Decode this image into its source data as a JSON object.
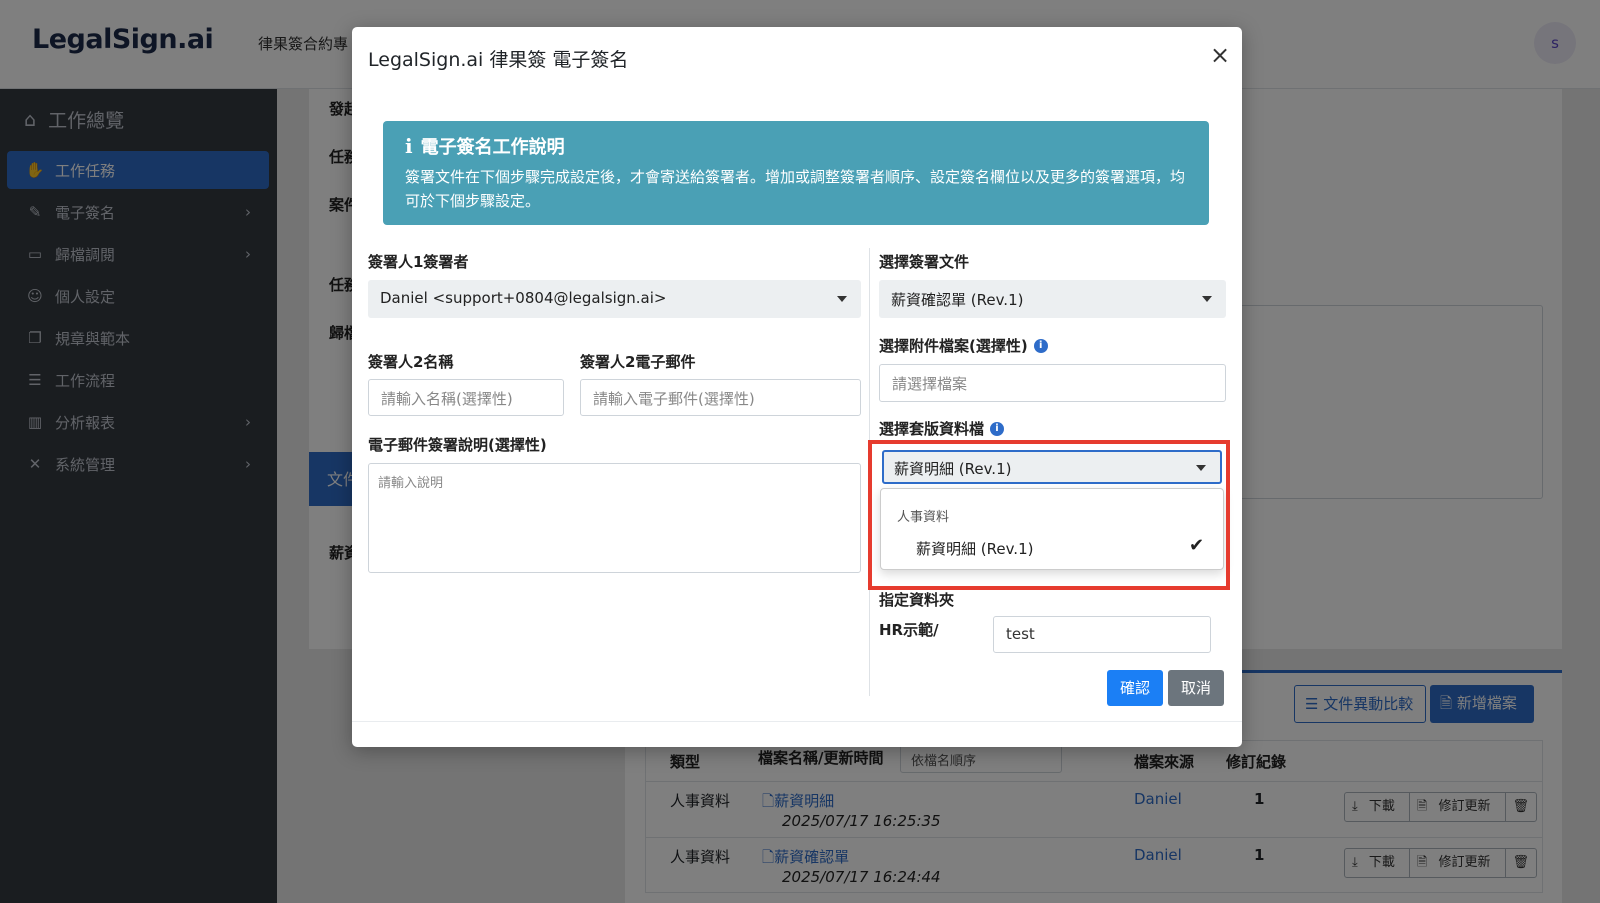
{
  "app": {
    "logo": "LegalSign.ai",
    "tagline": "律果簽合約專",
    "avatar": "s"
  },
  "sidebar": {
    "header": "工作總覽",
    "items": [
      {
        "label": "工作任務",
        "icon": "handshake-icon",
        "active": true
      },
      {
        "label": "電子簽名",
        "icon": "signature-icon",
        "chevron": true
      },
      {
        "label": "歸檔調閱",
        "icon": "archive-icon",
        "chevron": true
      },
      {
        "label": "個人設定",
        "icon": "user-cog-icon"
      },
      {
        "label": "規章與範本",
        "icon": "copy-icon"
      },
      {
        "label": "工作流程",
        "icon": "list-check-icon"
      },
      {
        "label": "分析報表",
        "icon": "chart-icon",
        "chevron": true
      },
      {
        "label": "系統管理",
        "icon": "tools-icon",
        "chevron": true
      }
    ]
  },
  "background": {
    "labels": [
      "發起",
      "任務",
      "案件",
      "任務",
      "歸檔",
      "薪資"
    ],
    "tab_label": "文件",
    "compare_button": "文件異動比較",
    "new_file_button": "新增檔案",
    "table": {
      "headers": [
        "類型",
        "檔案名稱/更新時間",
        "檔案來源",
        "修訂紀錄"
      ],
      "sort_select": "依檔名順序",
      "rows": [
        {
          "type": "人事資料",
          "name": "薪資明細",
          "time": "2025/07/17 16:25:35",
          "source": "Daniel",
          "revisions": "1"
        },
        {
          "type": "人事資料",
          "name": "薪資確認單",
          "time": "2025/07/17 16:24:44",
          "source": "Daniel",
          "revisions": "1"
        }
      ],
      "download": "下載",
      "revise": "修訂更新"
    }
  },
  "modal": {
    "title": "LegalSign.ai 律果簽 電子簽名",
    "close": "×",
    "info": {
      "heading": "電子簽名工作說明",
      "text": "簽署文件在下個步驟完成設定後，才會寄送給簽署者。增加或調整簽署者順序、設定簽名欄位以及更多的簽署選項，均可於下個步驟設定。"
    },
    "signer1_label": "簽署人1簽署者",
    "signer1_value": "Daniel <support+0804@legalsign.ai>",
    "signer2_name_label": "簽署人2名稱",
    "signer2_name_placeholder": "請輸入名稱(選擇性)",
    "signer2_email_label": "簽署人2電子郵件",
    "signer2_email_placeholder": "請輸入電子郵件(選擇性)",
    "email_note_label": "電子郵件簽署說明(選擇性)",
    "email_note_placeholder": "請輸入說明",
    "doc_label": "選擇簽署文件",
    "doc_value": "薪資確認單 (Rev.1)",
    "attach_label": "選擇附件檔案(選擇性)",
    "attach_placeholder": "請選擇檔案",
    "template_label": "選擇套版資料檔",
    "template_value": "薪資明細 (Rev.1)",
    "dropdown": {
      "group": "人事資料",
      "option": "薪資明細 (Rev.1)"
    },
    "folder_label": "指定資料夾",
    "folder_path": "HR示範/",
    "folder_value": "test",
    "confirm": "確認",
    "cancel": "取消"
  },
  "colors": {
    "accent": "#2e6cc9",
    "info_box": "#4aa0b5",
    "highlight": "#e63b2e",
    "sidebar": "#343a40"
  }
}
